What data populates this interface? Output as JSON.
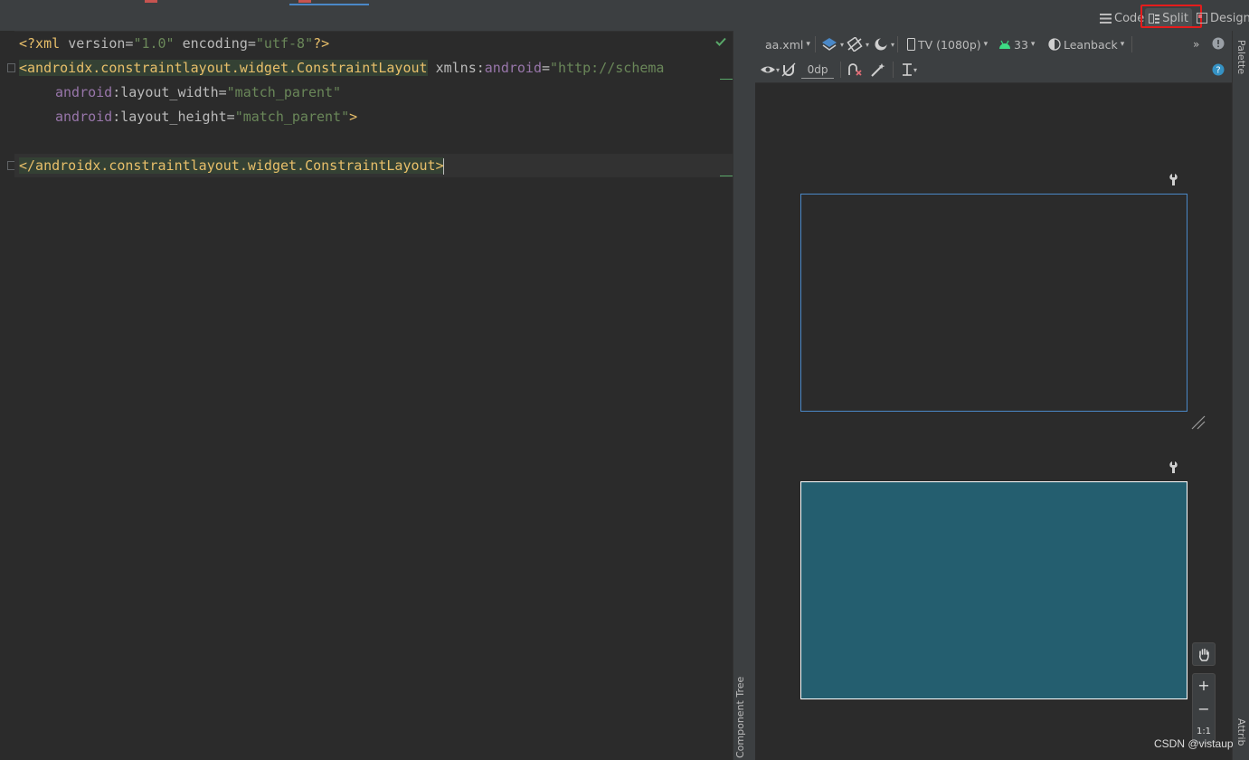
{
  "header": {
    "mode_buttons": {
      "code": "Code",
      "split": "Split",
      "design": "Design"
    }
  },
  "editor": {
    "lines": {
      "l1": {
        "open": "<?xml ",
        "a1": "version",
        "eq1": "=",
        "v1": "\"1.0\"",
        "sp": " ",
        "a2": "encoding",
        "eq2": "=",
        "v2": "\"utf-8\"",
        "close": "?>"
      },
      "l2": {
        "tag": "<androidx.constraintlayout.widget.ConstraintLayout",
        "sp": " ",
        "ns_attr": "xmlns",
        "colon": ":",
        "ns": "android",
        "eq": "=",
        "val": "\"http://schema"
      },
      "l3": {
        "ns": "android",
        "colon": ":",
        "attr": "layout_width",
        "eq": "=",
        "val": "\"match_parent\""
      },
      "l4": {
        "ns": "android",
        "colon": ":",
        "attr": "layout_height",
        "eq": "=",
        "val": "\"match_parent\"",
        "close": ">"
      },
      "l6": {
        "tag": "</androidx.constraintlayout.widget.ConstraintLayout>"
      }
    },
    "inspection_icon": "check-icon",
    "accent_color": "#59a869"
  },
  "design_toolbar": {
    "file": "aa.xml",
    "device": "TV (1080p)",
    "api_level": "33",
    "theme": "Leanback",
    "margin_default": "0dp"
  },
  "side_panels": {
    "component_tree": "Component Tree",
    "palette": "Palette",
    "attributes": "Attrib"
  },
  "zoom": {
    "plus": "+",
    "minus": "−",
    "one_to_one": "1:1"
  },
  "watermark": "CSDN @vistaup",
  "colors": {
    "background": "#2b2b2b",
    "toolbar": "#3c3f41",
    "highlight_red": "#e51c1c",
    "blueprint_border": "#4a88c7",
    "design_screen": "#245e6f"
  }
}
